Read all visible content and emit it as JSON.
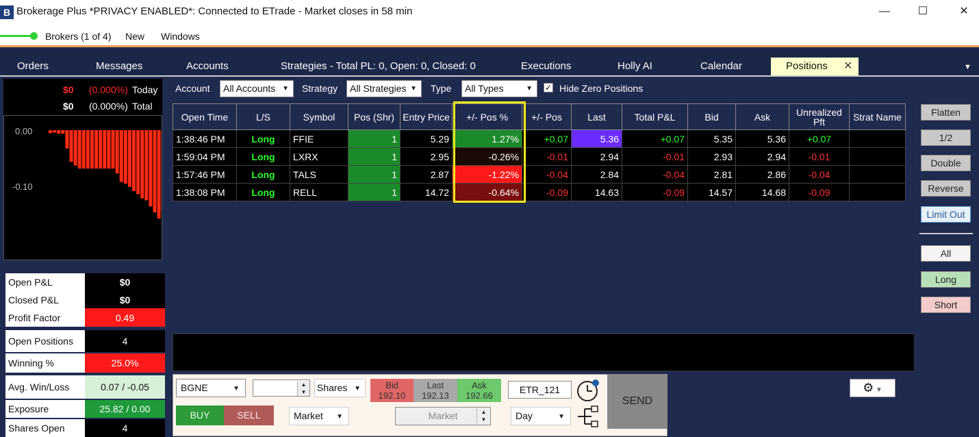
{
  "window": {
    "logo": "B",
    "title": "Brokerage Plus *PRIVACY ENABLED*: Connected to ETrade - Market closes in 58 min",
    "minimize": "—",
    "maximize": "☐",
    "close": "✕"
  },
  "menu": {
    "brokers": "Brokers (1 of 4)",
    "new": "New",
    "windows": "Windows"
  },
  "tabs": [
    "Orders",
    "Messages",
    "Accounts",
    "Strategies - Total PL: 0, Open: 0, Closed: 0",
    "Executions",
    "Holly AI",
    "Calendar",
    "Positions"
  ],
  "summary": {
    "today_value": "$0",
    "today_pct": "(0.000%)",
    "today_label": "Today",
    "total_value": "$0",
    "total_pct": "(0.000%)",
    "total_label": "Total"
  },
  "chart_data": {
    "type": "bar",
    "yticks": [
      "0.00",
      "-0.10"
    ],
    "ylim": [
      -0.16,
      0.01
    ],
    "values": [
      -0.005,
      -0.004,
      -0.006,
      -0.006,
      -0.03,
      -0.052,
      -0.058,
      -0.063,
      -0.063,
      -0.063,
      -0.063,
      -0.063,
      -0.063,
      -0.063,
      -0.063,
      -0.063,
      -0.071,
      -0.085,
      -0.088,
      -0.093,
      -0.1,
      -0.105,
      -0.112,
      -0.115,
      -0.125,
      -0.135,
      -0.145,
      -0.132,
      -0.125,
      -0.14,
      -0.125,
      -0.125
    ],
    "color": "#ff2a14"
  },
  "stats": [
    {
      "label": "Open P&L",
      "value": "$0",
      "bg": "#000000"
    },
    {
      "label": "Closed P&L",
      "value": "$0",
      "bg": "#000000"
    },
    {
      "label": "Profit Factor",
      "value": "0.49",
      "bg": "#ff1a1a"
    },
    {
      "label": "Open Positions",
      "value": "4",
      "bg": "#000000"
    },
    {
      "label": "Winning %",
      "value": "25.0%",
      "bg": "#ff1a1a"
    },
    {
      "label": "Avg. Win/Loss",
      "value": "0.07 / -0.05",
      "bg": "#d8efd8"
    },
    {
      "label": "Exposure",
      "value": "25.82 / 0.00",
      "bg": "#1f9a3a"
    },
    {
      "label": "Shares Open",
      "value": "4",
      "bg": "#000000"
    }
  ],
  "filters": {
    "account_label": "Account",
    "account_value": "All Accounts",
    "strategy_label": "Strategy",
    "strategy_value": "All Strategies",
    "type_label": "Type",
    "type_value": "All Types",
    "hide_zero_label": "Hide Zero Positions",
    "hide_zero_check": "✓"
  },
  "table": {
    "headers": [
      "Open Time",
      "L/S",
      "Symbol",
      "Pos (Shr)",
      "Entry Price",
      "+/- Pos %",
      "+/- Pos",
      "Last",
      "Total P&L",
      "Bid",
      "Ask",
      "Unrealized Pft",
      "Strat Name"
    ],
    "rows": [
      {
        "open_time": "1:38:46 PM",
        "ls": "Long",
        "symbol": "FFIE",
        "pos": "1",
        "entry": "5.29",
        "pos_pct": "1.27%",
        "pos_pct_bg": "#1b8a2a",
        "pos_chg": "+0.07",
        "last": "5.36",
        "last_bg": "#6a2cff",
        "total_pl": "+0.07",
        "bid": "5.35",
        "ask": "5.36",
        "unreal": "+0.07",
        "strat": ""
      },
      {
        "open_time": "1:59:04 PM",
        "ls": "Long",
        "symbol": "LXRX",
        "pos": "1",
        "entry": "2.95",
        "pos_pct": "-0.26%",
        "pos_pct_bg": "#1a0a05",
        "pos_chg": "-0.01",
        "last": "2.94",
        "last_bg": "#000000",
        "total_pl": "-0.01",
        "bid": "2.93",
        "ask": "2.94",
        "unreal": "-0.01",
        "strat": ""
      },
      {
        "open_time": "1:57:46 PM",
        "ls": "Long",
        "symbol": "TALS",
        "pos": "1",
        "entry": "2.87",
        "pos_pct": "-1.22%",
        "pos_pct_bg": "#ff1a1a",
        "pos_chg": "-0.04",
        "last": "2.84",
        "last_bg": "#000000",
        "total_pl": "-0.04",
        "bid": "2.81",
        "ask": "2.86",
        "unreal": "-0.04",
        "strat": ""
      },
      {
        "open_time": "1:38:08 PM",
        "ls": "Long",
        "symbol": "RELL",
        "pos": "1",
        "entry": "14.72",
        "pos_pct": "-0.64%",
        "pos_pct_bg": "#7a0e0e",
        "pos_chg": "-0.09",
        "last": "14.63",
        "last_bg": "#000000",
        "total_pl": "-0.09",
        "bid": "14.57",
        "ask": "14.68",
        "unreal": "-0.09",
        "strat": ""
      }
    ]
  },
  "right_buttons": {
    "flatten": "Flatten",
    "half": "1/2",
    "double": "Double",
    "reverse": "Reverse",
    "limit_out": "Limit Out",
    "all": "All",
    "long": "Long",
    "short": "Short"
  },
  "order": {
    "symbol": "BGNE",
    "qty": "",
    "units": "Shares",
    "bid_label": "Bid",
    "bid": "192.10",
    "last_label": "Last",
    "last": "192.13",
    "ask_label": "Ask",
    "ask": "192.66",
    "account": "ETR_121",
    "buy": "BUY",
    "sell": "SELL",
    "order_type": "Market",
    "price": "Market",
    "tif": "Day",
    "send": "SEND"
  }
}
